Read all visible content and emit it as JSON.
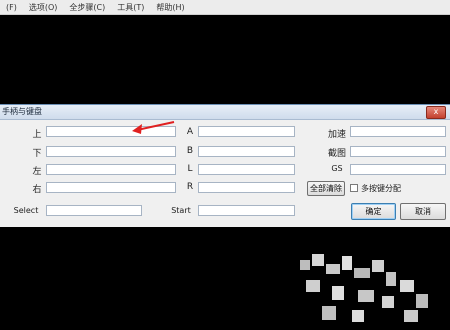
{
  "menubar": {
    "items": [
      "(F)",
      "选项(O)",
      "全步骤(C)",
      "工具(T)",
      "帮助(H)"
    ]
  },
  "dialog": {
    "title": "手柄与键盘",
    "close_glyph": "x",
    "col1": {
      "labels": [
        "上",
        "下",
        "左",
        "右",
        "Select"
      ]
    },
    "col2": {
      "labels": [
        "A",
        "B",
        "L",
        "R",
        "Start"
      ]
    },
    "col3": {
      "labels": [
        "加速",
        "截图",
        "GS"
      ]
    },
    "clear_all_label": "全部清除",
    "multi_key_label": "多按键分配",
    "ok_label": "确定",
    "cancel_label": "取消"
  },
  "colors": {
    "arrow": "#e02020",
    "default_button_border": "#3c7fb1"
  }
}
